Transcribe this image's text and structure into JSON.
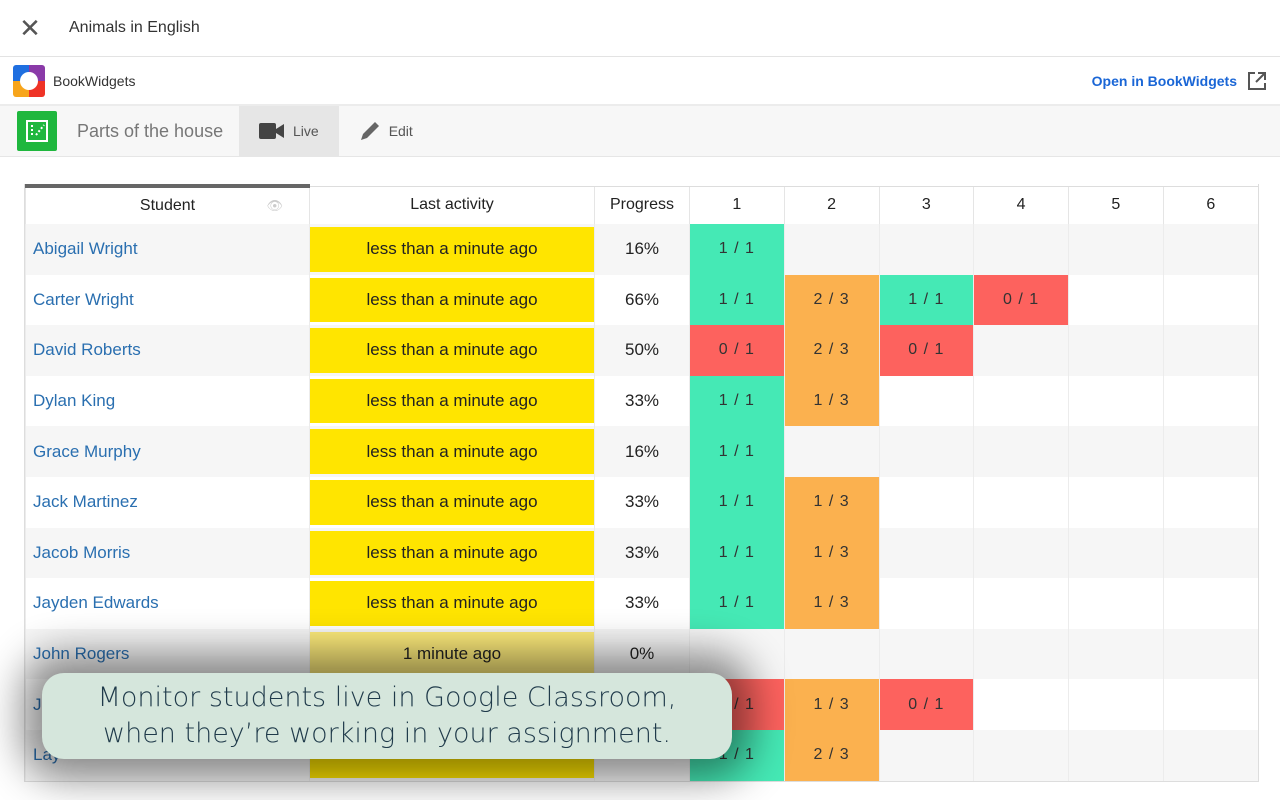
{
  "header": {
    "title": "Animals in English",
    "close_icon": "close-icon"
  },
  "brandbar": {
    "brand": "BookWidgets",
    "open_label": "Open in BookWidgets"
  },
  "tabbar": {
    "widget_name": "Parts of the house",
    "tabs": [
      {
        "label": "Live",
        "icon": "video-camera-icon",
        "active": true
      },
      {
        "label": "Edit",
        "icon": "pencil-icon",
        "active": false
      }
    ]
  },
  "table": {
    "headers": {
      "student": "Student",
      "last_activity": "Last activity",
      "progress": "Progress",
      "questions": [
        "1",
        "2",
        "3",
        "4",
        "5",
        "6"
      ]
    },
    "rows": [
      {
        "name": "Abigail Wright",
        "activity": "less than a minute ago",
        "progress": "16%",
        "scores": [
          [
            "1 / 1",
            "green"
          ]
        ]
      },
      {
        "name": "Carter Wright",
        "activity": "less than a minute ago",
        "progress": "66%",
        "scores": [
          [
            "1 / 1",
            "green"
          ],
          [
            "2 / 3",
            "orange"
          ],
          [
            "1 / 1",
            "green"
          ],
          [
            "0 / 1",
            "red"
          ]
        ]
      },
      {
        "name": "David Roberts",
        "activity": "less than a minute ago",
        "progress": "50%",
        "scores": [
          [
            "0 / 1",
            "red"
          ],
          [
            "2 / 3",
            "orange"
          ],
          [
            "0 / 1",
            "red"
          ]
        ]
      },
      {
        "name": "Dylan King",
        "activity": "less than a minute ago",
        "progress": "33%",
        "scores": [
          [
            "1 / 1",
            "green"
          ],
          [
            "1 / 3",
            "orange"
          ]
        ]
      },
      {
        "name": "Grace Murphy",
        "activity": "less than a minute ago",
        "progress": "16%",
        "scores": [
          [
            "1 / 1",
            "green"
          ]
        ]
      },
      {
        "name": "Jack Martinez",
        "activity": "less than a minute ago",
        "progress": "33%",
        "scores": [
          [
            "1 / 1",
            "green"
          ],
          [
            "1 / 3",
            "orange"
          ]
        ]
      },
      {
        "name": "Jacob Morris",
        "activity": "less than a minute ago",
        "progress": "33%",
        "scores": [
          [
            "1 / 1",
            "green"
          ],
          [
            "1 / 3",
            "orange"
          ]
        ]
      },
      {
        "name": "Jayden Edwards",
        "activity": "less than a minute ago",
        "progress": "33%",
        "scores": [
          [
            "1 / 1",
            "green"
          ],
          [
            "1 / 3",
            "orange"
          ]
        ]
      },
      {
        "name": "John Rogers",
        "activity": "1 minute ago",
        "progress": "0%",
        "old": true,
        "scores": []
      },
      {
        "name": "J",
        "activity": "",
        "progress": "",
        "scores": [
          [
            "0 / 1",
            "red"
          ],
          [
            "1 / 3",
            "orange"
          ],
          [
            "0 / 1",
            "red"
          ]
        ]
      },
      {
        "name": "Lay",
        "activity": "",
        "progress": "",
        "scores": [
          [
            "1 / 1",
            "green"
          ],
          [
            "2 / 3",
            "orange"
          ]
        ]
      }
    ]
  },
  "colors": {
    "green": "#45e9b5",
    "orange": "#fbb14f",
    "red": "#fd625e",
    "activity_yellow": "#ffe500",
    "link": "#2a6fb0",
    "accent": "#1a66d6"
  },
  "overlay": {
    "line1": "Monitor students live in Google Classroom,",
    "line2": "when they’re working in your assignment."
  }
}
